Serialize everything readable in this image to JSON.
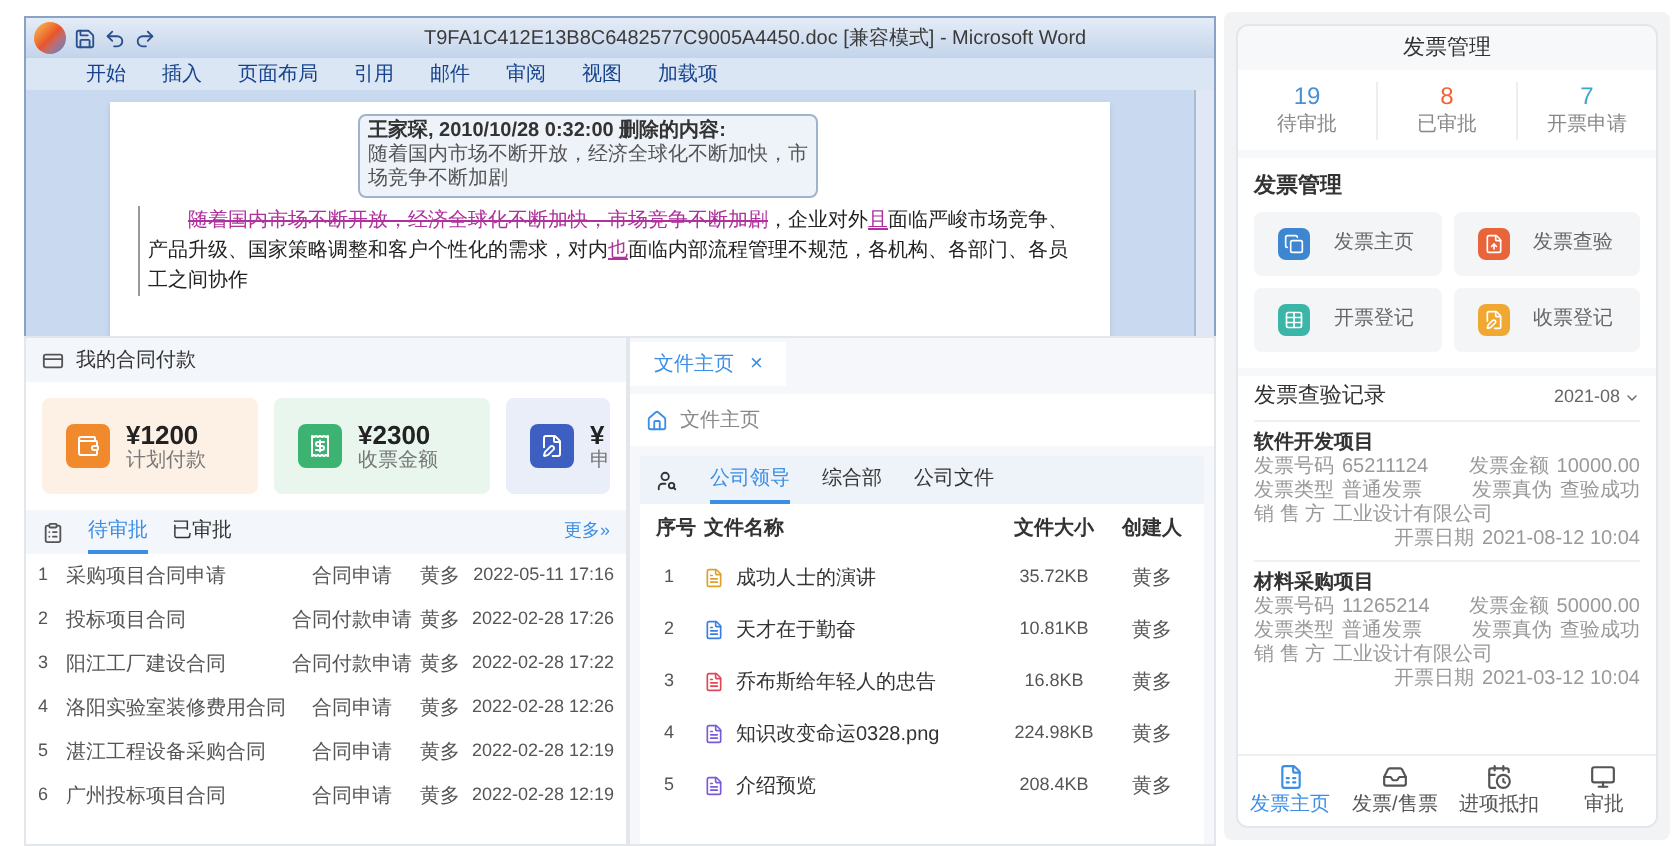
{
  "word_window": {
    "title": "T9FA1C412E13B8C6482577C9005A4450.doc [兼容模式] - Microsoft Word",
    "ribbon_tabs": [
      "开始",
      "插入",
      "页面布局",
      "引用",
      "邮件",
      "审阅",
      "视图",
      "加载项"
    ],
    "comment": {
      "header": "王家琛, 2010/10/28 0:32:00 删除的内容:",
      "text": "随着国内市场不断开放，经济全球化不断加快，市场竞争不断加剧"
    },
    "paragraph": [
      {
        "kind": "deleted",
        "text": "随着国内市场不断开放，经济全球化不断加快，市场竞争不断加剧"
      },
      {
        "kind": "normal",
        "text": "，企业对外"
      },
      {
        "kind": "inserted",
        "text": "且"
      },
      {
        "kind": "normal",
        "text": "面临严峻市场竞争、产品升级、国家策略调整和客户个性化的需求，对内"
      },
      {
        "kind": "inserted",
        "text": "也"
      },
      {
        "kind": "normal",
        "text": "面临内部流程管理不规范，各机构、各部门、各员工之间协作"
      }
    ]
  },
  "contract_panel": {
    "title": "我的合同付款",
    "cards": [
      {
        "kind": "plan",
        "amount": "¥1200",
        "label": "计划付款"
      },
      {
        "kind": "invoice",
        "amount": "¥2300",
        "label": "收票金额"
      },
      {
        "kind": "apply",
        "amount": "¥",
        "label": "申"
      }
    ],
    "tabs": [
      {
        "label": "待审批",
        "selected": true
      },
      {
        "label": "已审批",
        "selected": false
      }
    ],
    "more": "更多»",
    "rows": [
      {
        "no": "1",
        "name": "采购项目合同申请",
        "type": "合同申请",
        "person": "黄多",
        "date": "2022-05-11 17:16"
      },
      {
        "no": "2",
        "name": "投标项目合同",
        "type": "合同付款申请",
        "person": "黄多",
        "date": "2022-02-28 17:26"
      },
      {
        "no": "3",
        "name": "阳江工厂建设合同",
        "type": "合同付款申请",
        "person": "黄多",
        "date": "2022-02-28 17:22"
      },
      {
        "no": "4",
        "name": "洛阳实验室装修费用合同",
        "type": "合同申请",
        "person": "黄多",
        "date": "2022-02-28 12:26"
      },
      {
        "no": "5",
        "name": "湛江工程设备采购合同",
        "type": "合同申请",
        "person": "黄多",
        "date": "2022-02-28 12:19"
      },
      {
        "no": "6",
        "name": "广州投标项目合同",
        "type": "合同申请",
        "person": "黄多",
        "date": "2022-02-28 12:19"
      }
    ]
  },
  "file_panel": {
    "tab": {
      "label": "文件主页",
      "close": "×"
    },
    "breadcrumb": "文件主页",
    "tabs": [
      {
        "label": "公司领导",
        "selected": true
      },
      {
        "label": "综合部",
        "selected": false
      },
      {
        "label": "公司文件",
        "selected": false
      }
    ],
    "columns": [
      "序号",
      "文件名称",
      "文件大小",
      "创建人"
    ],
    "rows": [
      {
        "no": "1",
        "kind": "image",
        "name": "成功人士的演讲",
        "size": "35.72KB",
        "owner": "黄多"
      },
      {
        "no": "2",
        "kind": "doc",
        "name": "天才在于勤奋",
        "size": "10.81KB",
        "owner": "黄多"
      },
      {
        "no": "3",
        "kind": "pdf",
        "name": "乔布斯给年轻人的忠告",
        "size": "16.8KB",
        "owner": "黄多"
      },
      {
        "no": "4",
        "kind": "png",
        "name": "知识改变命运0328.png",
        "size": "224.98KB",
        "owner": "黄多"
      },
      {
        "no": "5",
        "kind": "png",
        "name": "介绍预览",
        "size": "208.4KB",
        "owner": "黄多"
      }
    ]
  },
  "invoice_app": {
    "title": "发票管理",
    "stats": [
      {
        "value": "19",
        "label": "待审批",
        "color": "#4a90d9"
      },
      {
        "value": "8",
        "label": "已审批",
        "color": "#f0643c"
      },
      {
        "value": "7",
        "label": "开票申请",
        "color": "#3aa8c8"
      }
    ],
    "section_title": "发票管理",
    "tiles": [
      {
        "kind": "home",
        "label": "发票主页"
      },
      {
        "kind": "check",
        "label": "发票查验"
      },
      {
        "kind": "issue",
        "label": "开票登记"
      },
      {
        "kind": "receive",
        "label": "收票登记"
      }
    ],
    "records_title": "发票查验记录",
    "month": "2021-08",
    "records": [
      {
        "title": "软件开发项目",
        "fields": [
          {
            "label": "发票号码",
            "value": "65211124"
          },
          {
            "label": "发票金额",
            "value": "10000.00"
          },
          {
            "label": "发票类型",
            "value": "普通发票"
          },
          {
            "label": "发票真伪",
            "value": "查验成功"
          },
          {
            "label": "销 售 方",
            "value": "工业设计有限公司"
          },
          {
            "label": "开票日期",
            "value": "2021-08-12 10:04"
          }
        ]
      },
      {
        "title": "材料采购项目",
        "fields": [
          {
            "label": "发票号码",
            "value": "11265214"
          },
          {
            "label": "发票金额",
            "value": "50000.00"
          },
          {
            "label": "发票类型",
            "value": "普通发票"
          },
          {
            "label": "发票真伪",
            "value": "查验成功"
          },
          {
            "label": "销 售 方",
            "value": "工业设计有限公司"
          },
          {
            "label": "开票日期",
            "value": "2021-03-12 10:04"
          }
        ]
      }
    ],
    "nav": [
      {
        "kind": "home",
        "label": "发票主页",
        "selected": true
      },
      {
        "kind": "ticket",
        "label": "发票/售票",
        "selected": false
      },
      {
        "kind": "deduct",
        "label": "进项抵扣",
        "selected": false
      },
      {
        "kind": "approve",
        "label": "审批",
        "selected": false
      }
    ]
  }
}
